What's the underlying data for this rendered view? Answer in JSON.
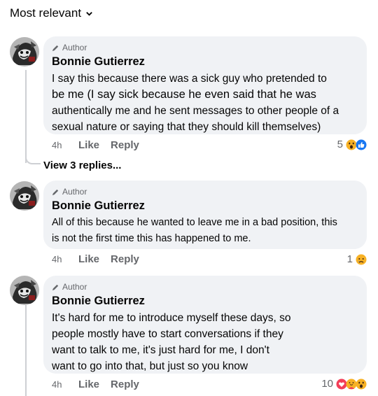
{
  "sort": {
    "label": "Most relevant"
  },
  "comments": [
    {
      "author_tag": "Author",
      "name": "Bonnie Gutierrez",
      "lines": [
        "I say this because there was a sick guy who pretended to",
        "be me (I say sick because he even said that he was",
        "authentically me and he sent messages to other people of a",
        "sexual nature or saying that they should kill themselves)"
      ],
      "time": "4h",
      "like": "Like",
      "reply": "Reply",
      "reaction_count": "5",
      "reactions": [
        "wow-emoji",
        "like-emoji"
      ]
    },
    {
      "author_tag": "Author",
      "name": "Bonnie Gutierrez",
      "lines": [
        "All of this because he wanted to leave me in a bad position, this",
        "is not the first time this has happened to me."
      ],
      "time": "4h",
      "like": "Like",
      "reply": "Reply",
      "reaction_count": "1",
      "reactions": [
        "sad-emoji"
      ]
    },
    {
      "author_tag": "Author",
      "name": "Bonnie Gutierrez",
      "lines": [
        "It's hard for me to introduce myself these days, so",
        "people mostly have to start conversations if they",
        "want to talk to me, it's just hard for me, I don't",
        "want to go into that, but just so you know"
      ],
      "time": "4h",
      "like": "Like",
      "reply": "Reply",
      "reaction_count": "10",
      "reactions": [
        "love-emoji",
        "care-emoji",
        "wow-emoji"
      ]
    }
  ],
  "view_replies": "View 3 replies...",
  "colors": {
    "bubble": "#f0f2f5",
    "secondary_text": "#65676b",
    "like_blue": "#1877f2",
    "love_red": "#f33e58",
    "emoji_yellow": "#f7b125"
  }
}
